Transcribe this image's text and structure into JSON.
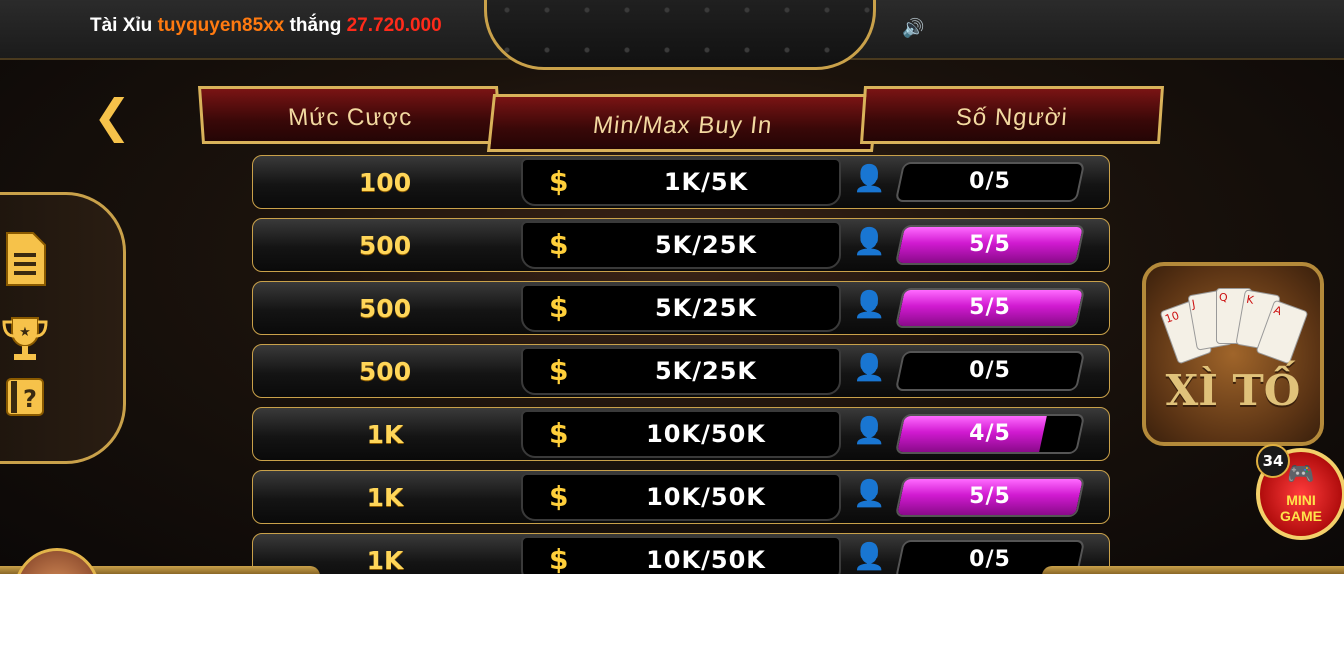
{
  "ticker": {
    "game": "Tài Xỉu",
    "user": "tuyquyen85xx",
    "verb": "thắng",
    "amount": "27.720.000"
  },
  "headers": {
    "bet": "Mức Cược",
    "buyin": "Min/Max Buy In",
    "players": "Số Người"
  },
  "rows": [
    {
      "bet": "100",
      "buyin": "1K/5K",
      "players": "0/5",
      "fill": 0
    },
    {
      "bet": "500",
      "buyin": "5K/25K",
      "players": "5/5",
      "fill": 1
    },
    {
      "bet": "500",
      "buyin": "5K/25K",
      "players": "5/5",
      "fill": 1
    },
    {
      "bet": "500",
      "buyin": "5K/25K",
      "players": "0/5",
      "fill": 0
    },
    {
      "bet": "1K",
      "buyin": "10K/50K",
      "players": "4/5",
      "fill": 0.8
    },
    {
      "bet": "1K",
      "buyin": "10K/50K",
      "players": "5/5",
      "fill": 1
    },
    {
      "bet": "1K",
      "buyin": "10K/50K",
      "players": "0/5",
      "fill": 0
    }
  ],
  "game_tile": {
    "title": "XÌ TỐ"
  },
  "mini_game": {
    "line1": "MINI",
    "line2": "GAME",
    "badge": "34"
  },
  "colors": {
    "accent_gold": "#c9a14a",
    "fill_magenta": "#d01ad0",
    "ticker_user": "#ff7a10",
    "ticker_amount": "#ff2a1a"
  },
  "icons": [
    "back-chevron-icon",
    "document-icon",
    "trophy-icon",
    "help-icon",
    "person-icon",
    "dollar-icon",
    "speaker-icon",
    "gamepad-icon"
  ]
}
